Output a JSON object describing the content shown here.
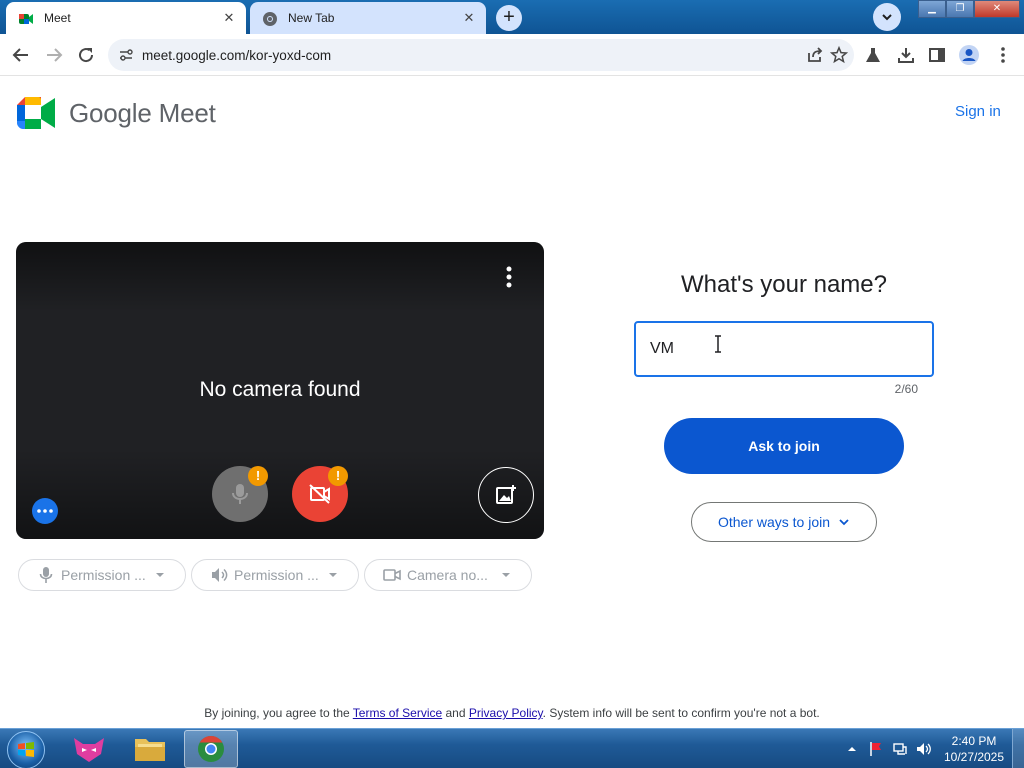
{
  "browser": {
    "tabs": [
      {
        "title": "Meet",
        "close": "✕"
      },
      {
        "title": "New Tab",
        "close": "✕"
      }
    ],
    "new_tab": "+",
    "url": "meet.google.com/kor-yoxd-com"
  },
  "header": {
    "brand": "Google Meet",
    "sign_in": "Sign in"
  },
  "preview": {
    "message": "No camera found",
    "warning_glyph": "!"
  },
  "permissions": [
    {
      "label": "Permission ...",
      "icon": "mic-icon"
    },
    {
      "label": "Permission ...",
      "icon": "speaker-icon"
    },
    {
      "label": "Camera no...",
      "icon": "camera-icon"
    }
  ],
  "join": {
    "heading": "What's your name?",
    "name_value": "VM",
    "counter": "2/60",
    "ask_label": "Ask to join",
    "other_label": "Other ways to join"
  },
  "legal": {
    "prefix": "By joining, you agree to the ",
    "terms": "Terms of Service",
    "and": " and ",
    "privacy": "Privacy Policy",
    "suffix": ". System info will be sent to confirm you're not a bot."
  },
  "taskbar": {
    "time": "2:40 PM",
    "date": "10/27/2025"
  },
  "colors": {
    "accent": "#1a73e8",
    "primary_button": "#0b57d0",
    "camera_off": "#ea4335",
    "warning": "#f29900"
  }
}
